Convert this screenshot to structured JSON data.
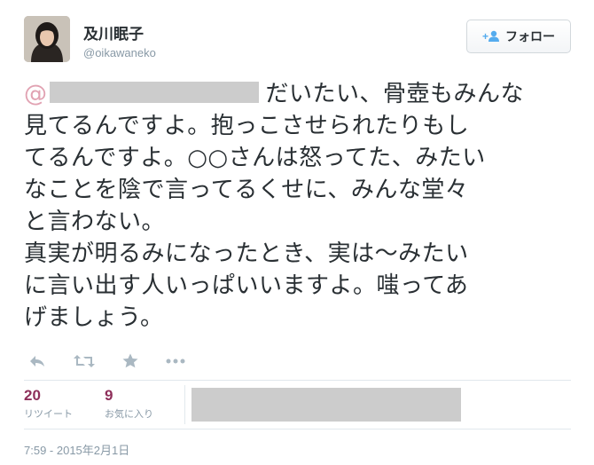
{
  "user": {
    "display_name": "及川眠子",
    "handle": "@oikawaneko",
    "avatar_icon": "profile-photo"
  },
  "follow_button": {
    "label": "フォロー",
    "icon": "add-user-icon"
  },
  "tweet": {
    "mention_prefix": "@",
    "lines": [
      "だいたい、骨壺もみんな",
      "見てるんですよ。抱っこさせられたりもし",
      "てるんですよ。○○さんは怒ってた、みたい",
      "なことを陰で言ってるくせに、みんな堂々",
      "と言わない。",
      "真実が明るみになったとき、実は〜みたい",
      "に言い出す人いっぱいいますよ。嗤ってあ",
      "げましょう。"
    ]
  },
  "actions": {
    "reply_icon": "reply-icon",
    "retweet_icon": "retweet-icon",
    "favorite_icon": "star-icon",
    "more_icon": "more-icon"
  },
  "stats": {
    "retweets": {
      "count": "20",
      "label": "リツイート"
    },
    "favorites": {
      "count": "9",
      "label": "お気に入り"
    }
  },
  "timestamp": "7:59 - 2015年2月1日",
  "colors": {
    "accent_count": "#8e2f5a",
    "mention": "#e1a2b2",
    "muted": "#8899a6",
    "redaction": "#cccccc"
  }
}
